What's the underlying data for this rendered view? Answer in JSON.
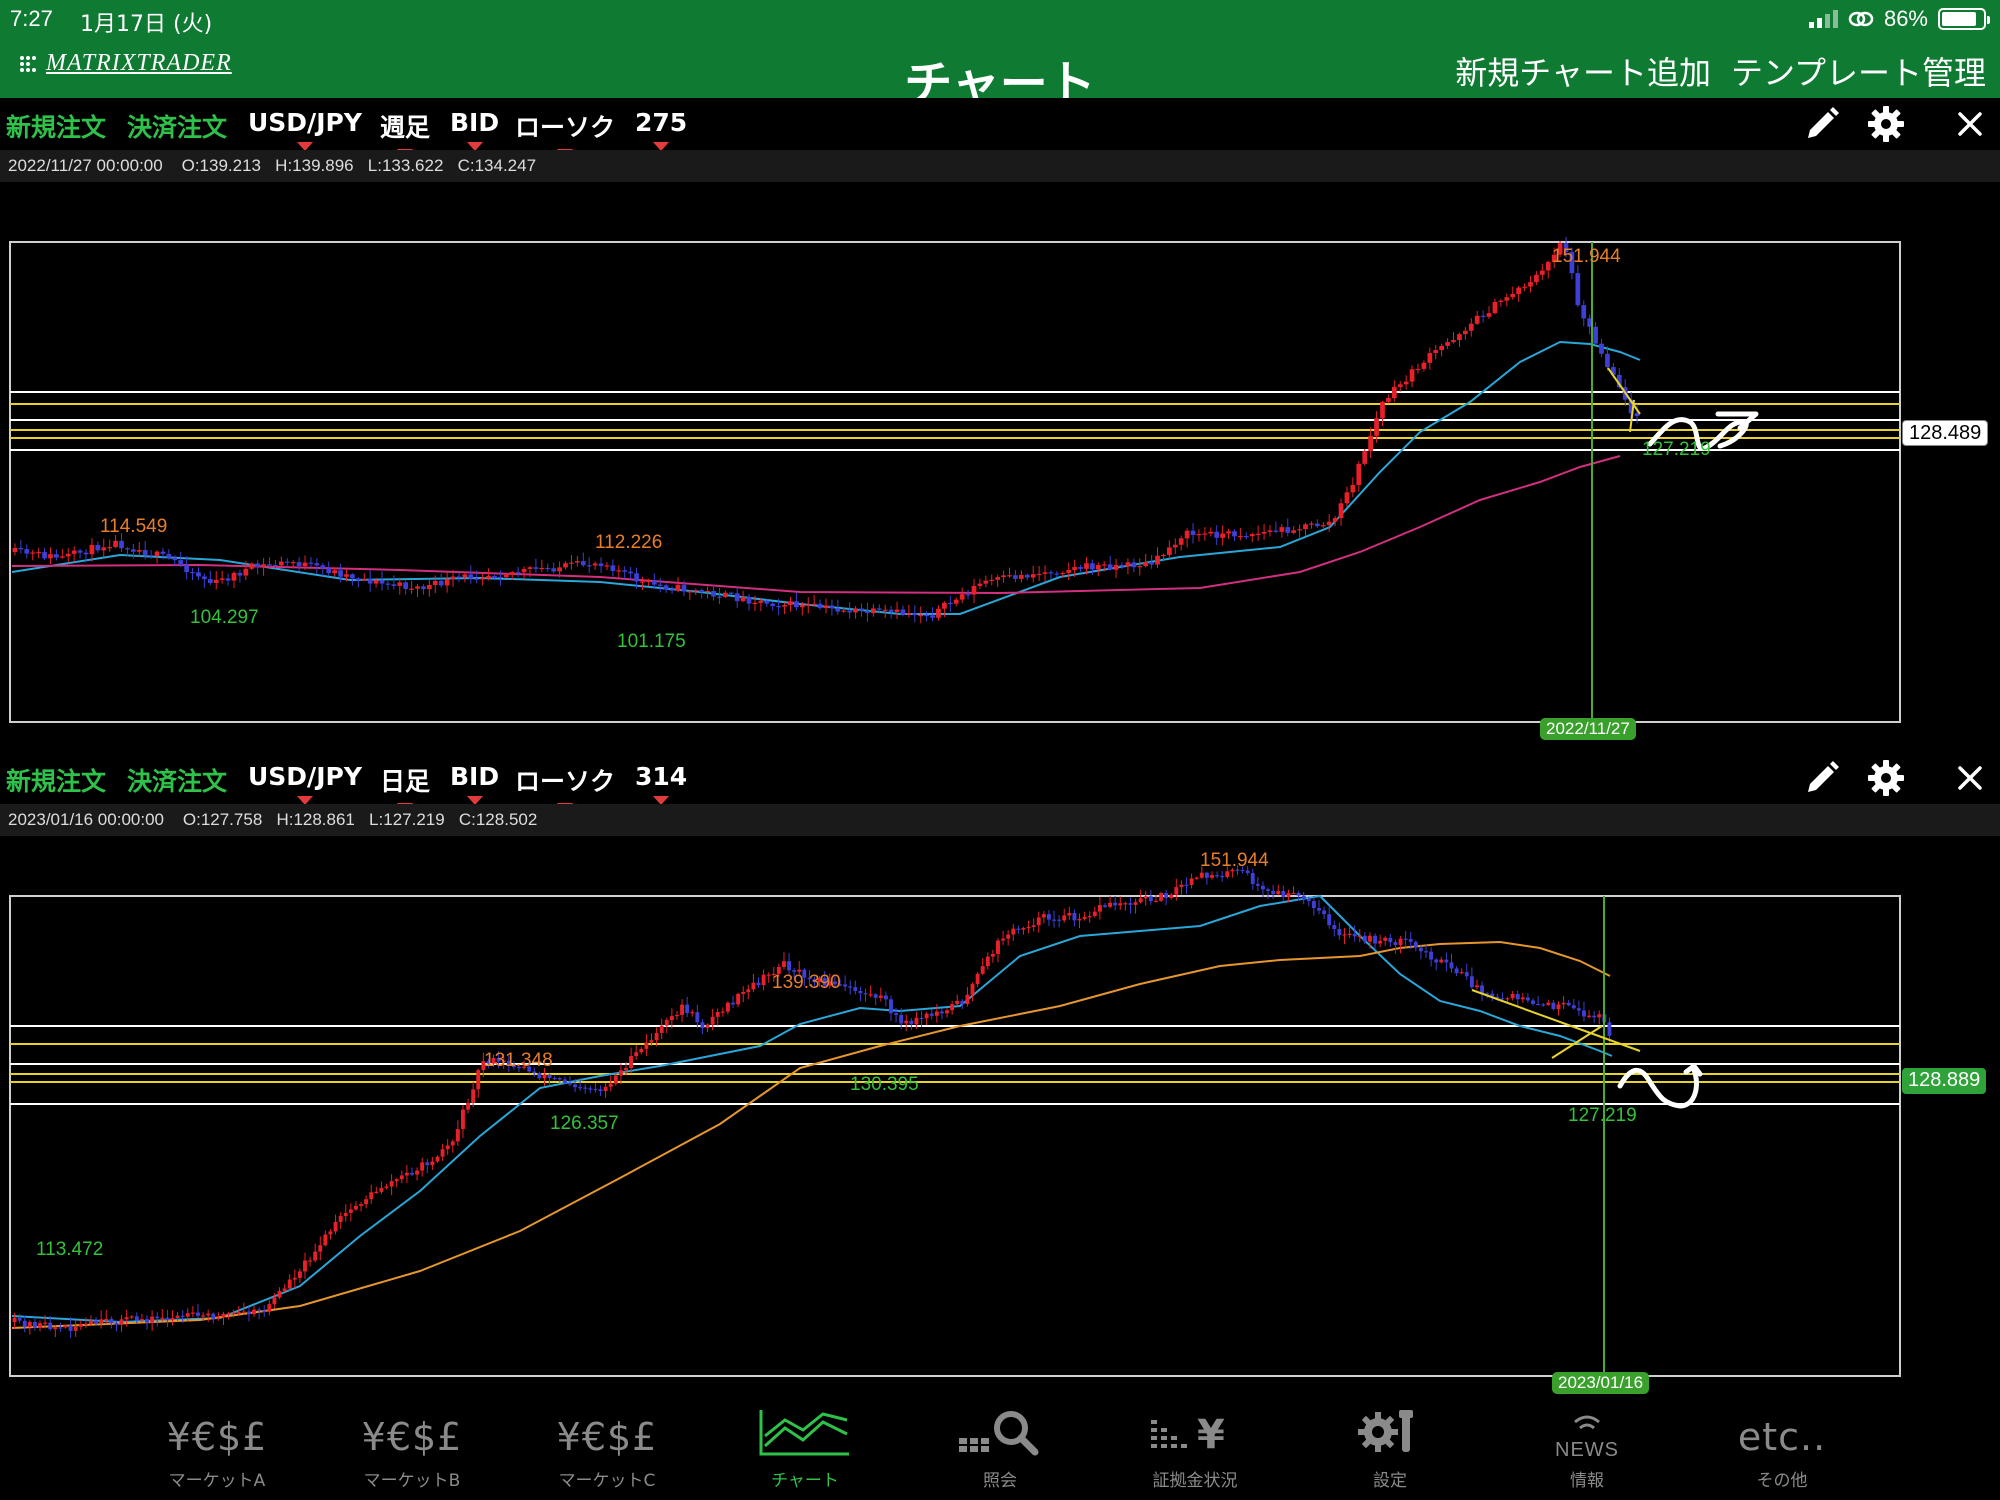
{
  "status": {
    "time": "7:27",
    "date": "1月17日 (火)",
    "battery": "86%",
    "battery_level": 0.86
  },
  "nav": {
    "brand": "MATRIXTRADER",
    "title": "チャート",
    "add_chart": "新規チャート追加",
    "template_manage": "テンプレート管理"
  },
  "panels": [
    {
      "new_order": "新規注文",
      "close_order": "決済注文",
      "symbol": "USD/JPY",
      "timeframe": "週足",
      "price_type": "BID",
      "chart_style": "ローソク",
      "count": "275",
      "ohlc": "2022/11/27 00:00:00    O:139.213   H:139.896   L:133.622   C:134.247",
      "price_tag": "128.489",
      "date_tag": "2022/11/27",
      "labels": [
        {
          "text": "151.944",
          "kind": "high"
        },
        {
          "text": "114.549",
          "kind": "high"
        },
        {
          "text": "112.226",
          "kind": "high"
        },
        {
          "text": "104.297",
          "kind": "low"
        },
        {
          "text": "101.175",
          "kind": "low"
        },
        {
          "text": "127.219",
          "kind": "low"
        }
      ]
    },
    {
      "new_order": "新規注文",
      "close_order": "決済注文",
      "symbol": "USD/JPY",
      "timeframe": "日足",
      "price_type": "BID",
      "chart_style": "ローソク",
      "count": "314",
      "ohlc": "2023/01/16 00:00:00    O:127.758   H:128.861   L:127.219   C:128.502",
      "price_tag": "128.889",
      "date_tag": "2023/01/16",
      "labels": [
        {
          "text": "151.944",
          "kind": "high"
        },
        {
          "text": "139.390",
          "kind": "high"
        },
        {
          "text": "131.348",
          "kind": "high"
        },
        {
          "text": "130.395",
          "kind": "low"
        },
        {
          "text": "126.357",
          "kind": "low"
        },
        {
          "text": "127.219",
          "kind": "low"
        },
        {
          "text": "113.472",
          "kind": "low"
        }
      ]
    }
  ],
  "tabs": [
    {
      "icon": "¥€$£",
      "label": "マーケットA",
      "icon_name": "currency-icon"
    },
    {
      "icon": "¥€$£",
      "label": "マーケットB",
      "icon_name": "currency-icon"
    },
    {
      "icon": "¥€$£",
      "label": "マーケットC",
      "icon_name": "currency-icon"
    },
    {
      "icon": "",
      "label": "チャート",
      "icon_name": "chart-icon",
      "active": true
    },
    {
      "icon": "",
      "label": "照会",
      "icon_name": "search-icon"
    },
    {
      "icon": "",
      "label": "証拠金状況",
      "icon_name": "margin-icon"
    },
    {
      "icon": "",
      "label": "設定",
      "icon_name": "settings-icon"
    },
    {
      "icon": "NEWS",
      "label": "情報",
      "icon_name": "news-icon"
    },
    {
      "icon": "etc..",
      "label": "その他",
      "icon_name": "etc-icon"
    }
  ],
  "colors": {
    "header_green": "#0f7a32",
    "accent_green": "#2fc24a",
    "bull": "#e8202a",
    "bear": "#3d3fd6",
    "high_label": "#e87e2a",
    "low_label": "#33c23a"
  }
}
